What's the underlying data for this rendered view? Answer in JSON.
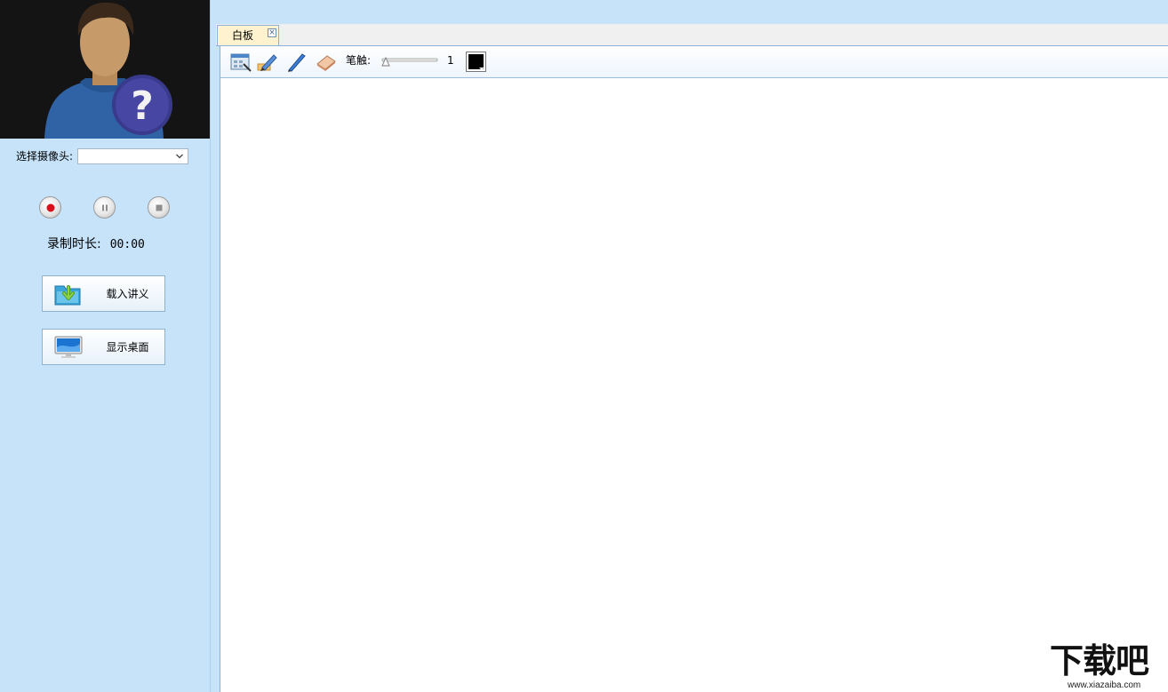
{
  "left_panel": {
    "camera_label": "选择摄像头:",
    "camera_selected": "",
    "record_duration_label": "录制时长:",
    "record_duration_value": "00:00",
    "load_lecture_label": "载入讲义",
    "show_desktop_label": "显示桌面"
  },
  "tabs": [
    {
      "label": "白板",
      "active": true
    }
  ],
  "toolbar": {
    "icons": [
      "whiteboard-settings-icon",
      "highlighter-icon",
      "pen-icon",
      "eraser-icon"
    ],
    "stroke_label": "笔触:",
    "stroke_value": "1",
    "stroke_level": 0,
    "color": "#000000"
  },
  "watermark": {
    "brand": "下载吧",
    "url": "www.xiazaiba.com"
  },
  "colors": {
    "panel_bg": "#c6e3f9",
    "tab_active_bg": "#fff3cf",
    "record_red": "#d8101a"
  }
}
